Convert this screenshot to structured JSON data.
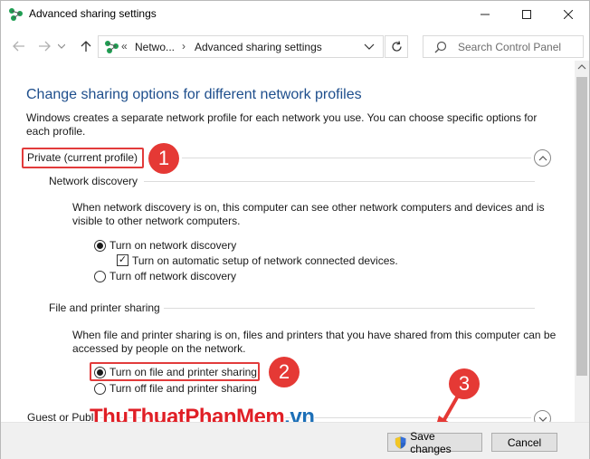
{
  "window": {
    "title": "Advanced sharing settings"
  },
  "address_bar": {
    "overflow": "«",
    "crumbs": [
      "Netwo...",
      "Advanced sharing settings"
    ],
    "search_placeholder": "Search Control Panel"
  },
  "main": {
    "heading": "Change sharing options for different network profiles",
    "description": "Windows creates a separate network profile for each network you use. You can choose specific options for each profile.",
    "private_profile": {
      "label": "Private (current profile)",
      "network_discovery": {
        "title": "Network discovery",
        "description": "When network discovery is on, this computer can see other network computers and devices and is visible to other network computers.",
        "options": [
          {
            "label": "Turn on network discovery",
            "selected": true
          },
          {
            "label": "Turn off network discovery",
            "selected": false
          }
        ],
        "auto_setup": {
          "label": "Turn on automatic setup of network connected devices.",
          "checked": true
        }
      },
      "file_printer_sharing": {
        "title": "File and printer sharing",
        "description": "When file and printer sharing is on, files and printers that you have shared from this computer can be accessed by people on the network.",
        "options": [
          {
            "label": "Turn on file and printer sharing",
            "selected": true
          },
          {
            "label": "Turn off file and printer sharing",
            "selected": false
          }
        ]
      }
    },
    "guest_profile": {
      "label": "Guest or Publi"
    }
  },
  "footer": {
    "save_label": "Save changes",
    "cancel_label": "Cancel"
  },
  "annotations": {
    "badges": [
      "1",
      "2",
      "3"
    ],
    "color": "#e53935"
  },
  "watermark": {
    "part1": "ThuThuat",
    "part2": "PhanMem",
    "part3": ".vn"
  },
  "colors": {
    "heading": "#1e4e8c",
    "highlight_box": "#e23b3b"
  }
}
